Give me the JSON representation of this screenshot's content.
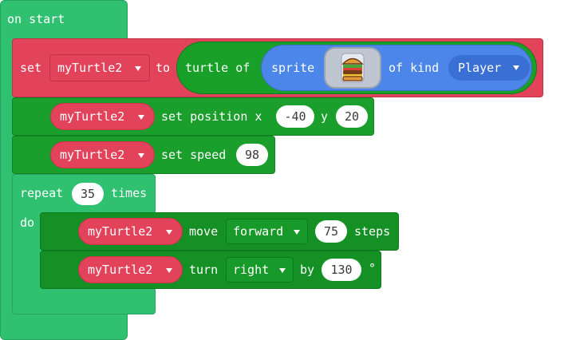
{
  "hat": {
    "label": "on start"
  },
  "set_block": {
    "set_label": "set",
    "var_name": "myTurtle2",
    "to_label": "to",
    "turtle_of_label": "turtle of",
    "sprite_label": "sprite",
    "of_kind_label": "of kind",
    "kind_value": "Player",
    "sprite_image": "burger-icon"
  },
  "set_position": {
    "var_name": "myTurtle2",
    "label": "set position x",
    "x_value": "-40",
    "y_label": "y",
    "y_value": "20"
  },
  "set_speed": {
    "var_name": "myTurtle2",
    "label": "set speed",
    "speed_value": "98"
  },
  "repeat": {
    "label": "repeat",
    "count": "35",
    "times_label": "times",
    "do_label": "do"
  },
  "move": {
    "var_name": "myTurtle2",
    "label": "move",
    "direction": "forward",
    "steps_value": "75",
    "steps_label": "steps"
  },
  "turn": {
    "var_name": "myTurtle2",
    "label": "turn",
    "direction": "right",
    "by_label": "by",
    "angle_value": "130",
    "degree_symbol": "°"
  },
  "colors": {
    "hat_green": "#2fc070",
    "set_red": "#e3425b",
    "turtle_green": "#1a9e2c",
    "sprite_blue": "#4c86e8"
  }
}
